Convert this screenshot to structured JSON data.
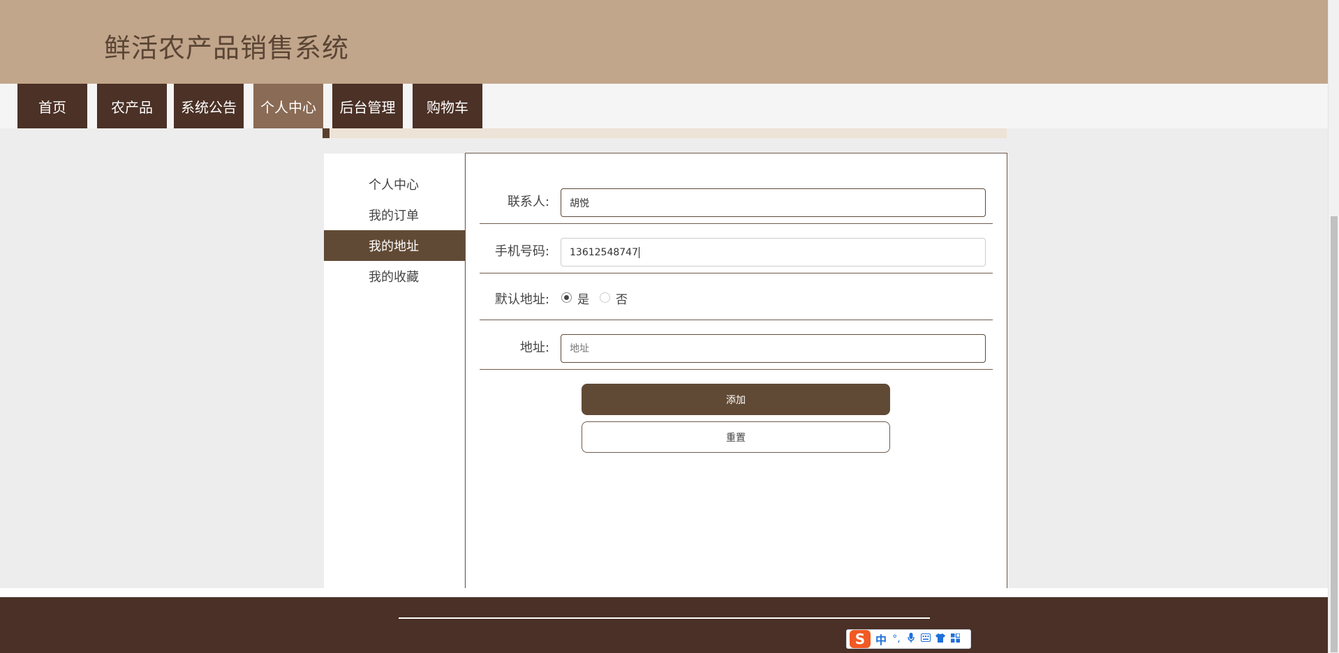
{
  "header": {
    "title": "鲜活农产品销售系统"
  },
  "nav": {
    "items": [
      {
        "label": "首页"
      },
      {
        "label": "农产品"
      },
      {
        "label": "系统公告"
      },
      {
        "label": "个人中心",
        "active": true
      },
      {
        "label": "后台管理"
      },
      {
        "label": "购物车"
      }
    ]
  },
  "sidebar": {
    "items": [
      {
        "label": "个人中心"
      },
      {
        "label": "我的订单"
      },
      {
        "label": "我的地址",
        "active": true
      },
      {
        "label": "我的收藏"
      }
    ]
  },
  "form": {
    "contact_label": "联系人:",
    "contact_value": "胡悦",
    "phone_label": "手机号码:",
    "phone_value": "13612548747",
    "default_label": "默认地址:",
    "default_yes": "是",
    "default_no": "否",
    "default_selected": "是",
    "address_label": "地址:",
    "address_placeholder": "地址",
    "add_button": "添加",
    "reset_button": "重置"
  },
  "ime": {
    "logo": "S",
    "lang": "中",
    "icons": [
      "punctuation-icon",
      "microphone-icon",
      "keyboard-icon",
      "skin-icon",
      "toolbox-icon"
    ]
  },
  "colors": {
    "header_bg": "#c2a68b",
    "nav_bg": "#4b3126",
    "nav_active": "#8a6b55",
    "accent": "#614a35",
    "footer_bg": "#4a3026"
  }
}
